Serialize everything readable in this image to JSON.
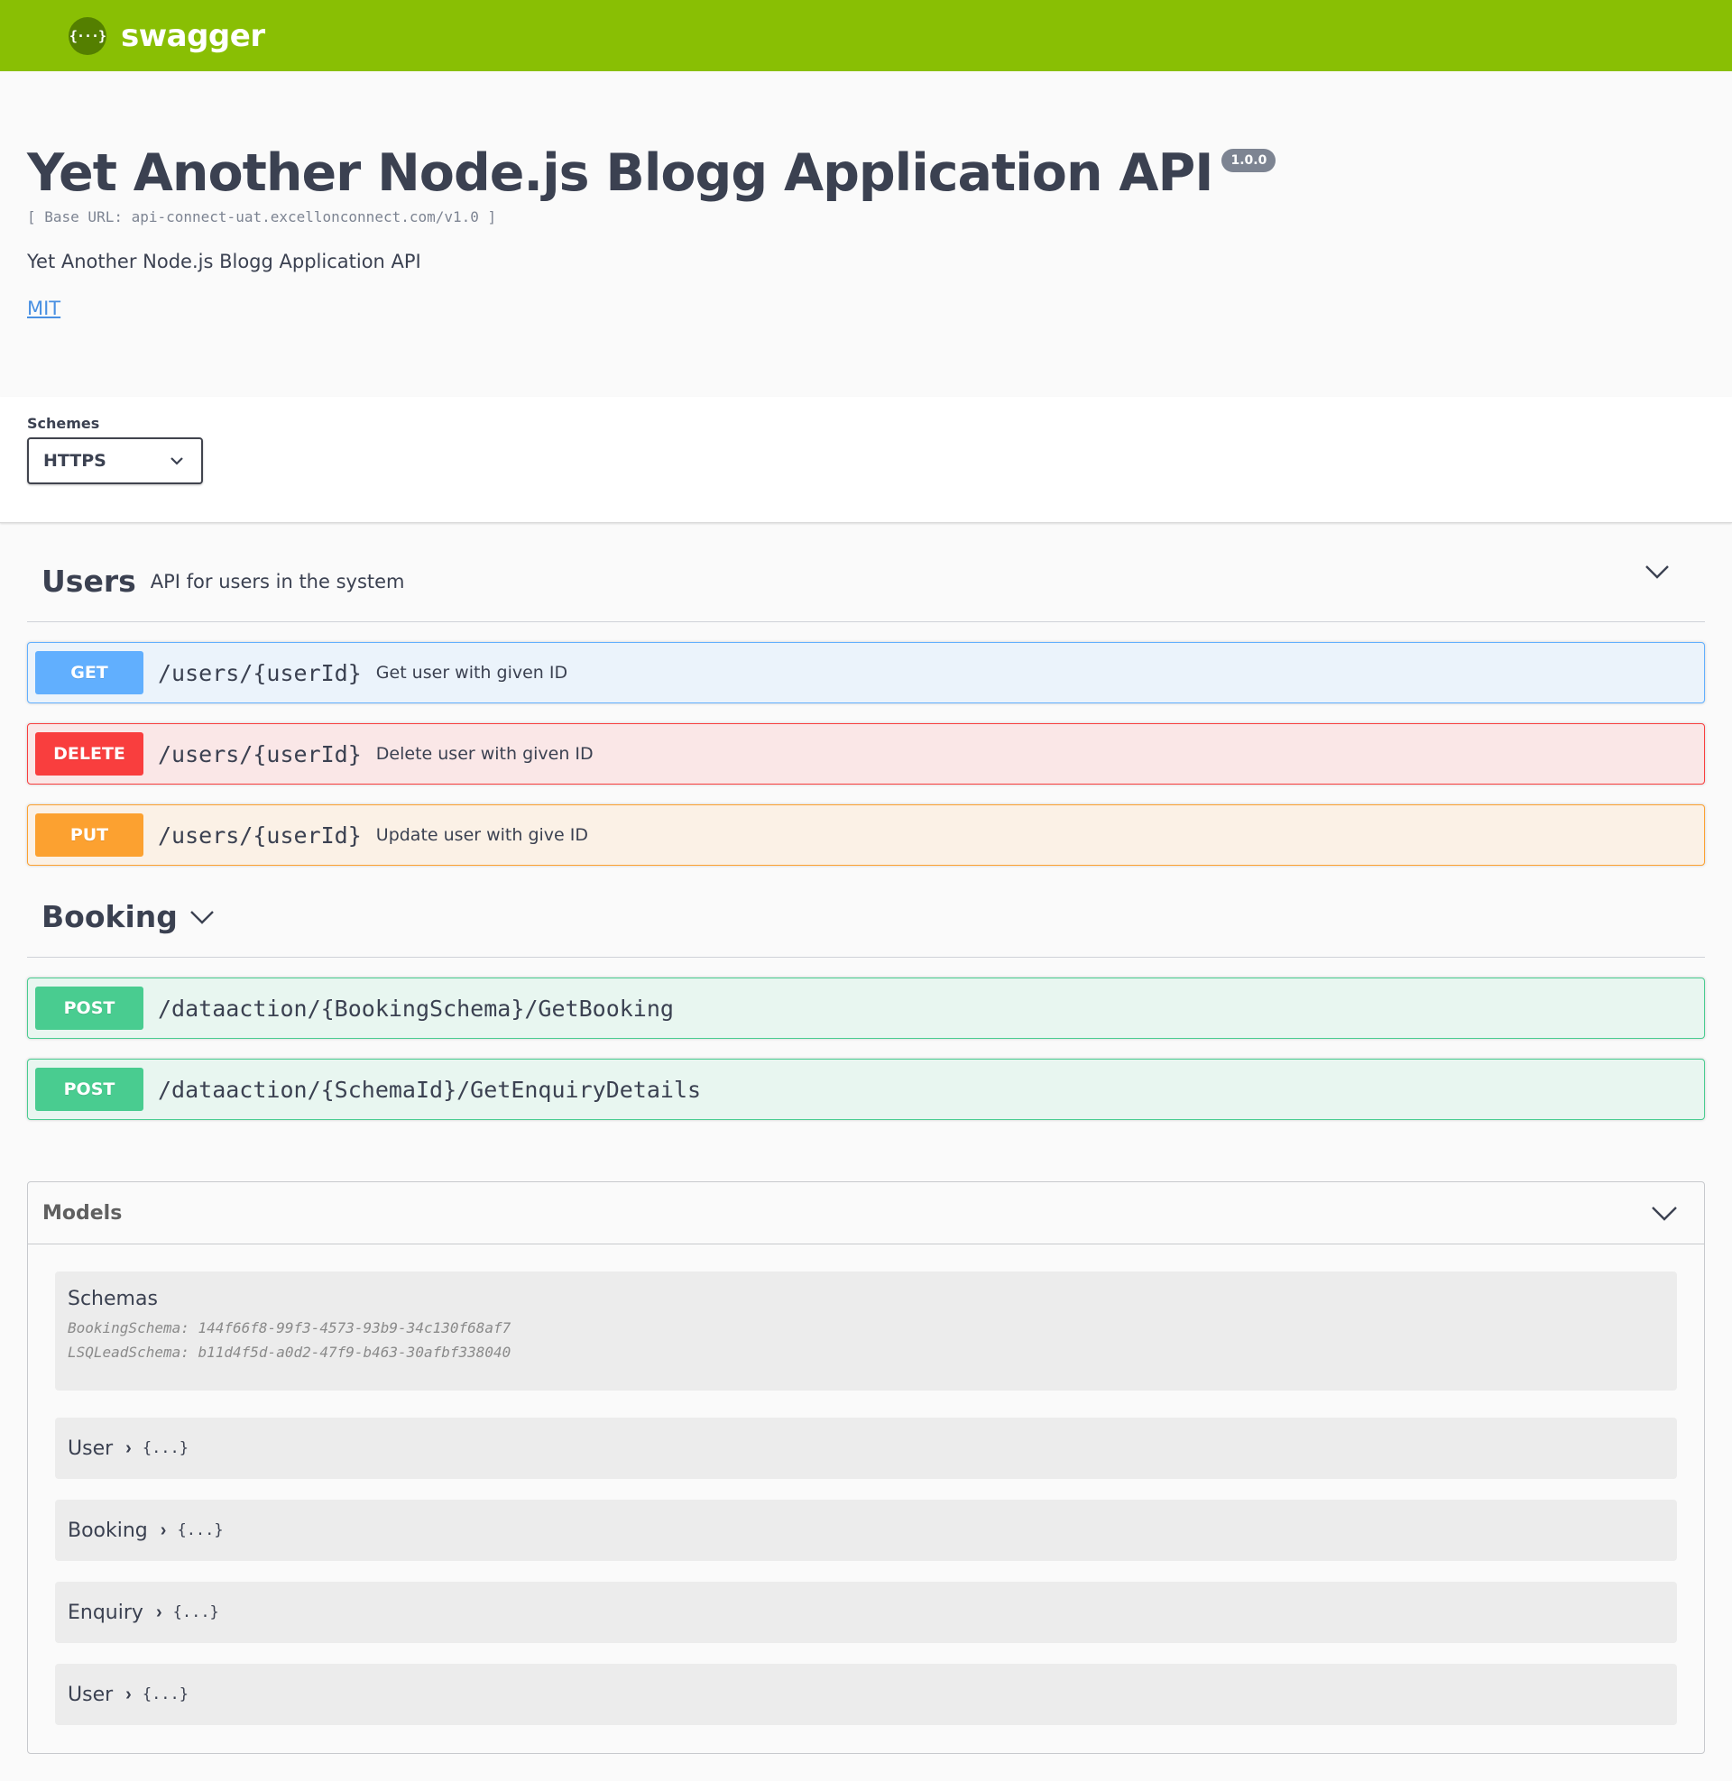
{
  "topbar": {
    "logo_glyph": "{···}",
    "brand": "swagger",
    "color": "#89bf04"
  },
  "info": {
    "title": "Yet Another Node.js Blogg Application API",
    "version": "1.0.0",
    "base_url": "[ Base URL: api-connect-uat.excellonconnect.com/v1.0 ]",
    "description": "Yet Another Node.js Blogg Application API",
    "license": "MIT"
  },
  "schemes": {
    "label": "Schemes",
    "selected": "HTTPS"
  },
  "tags": [
    {
      "name": "Users",
      "description": "API for users in the system",
      "operations": [
        {
          "method": "GET",
          "path": "/users/{userId}",
          "summary": "Get user with given ID"
        },
        {
          "method": "DELETE",
          "path": "/users/{userId}",
          "summary": "Delete user with given ID"
        },
        {
          "method": "PUT",
          "path": "/users/{userId}",
          "summary": "Update user with give ID"
        }
      ]
    },
    {
      "name": "Booking",
      "description": "",
      "operations": [
        {
          "method": "POST",
          "path": "/dataaction/{BookingSchema}/GetBooking",
          "summary": ""
        },
        {
          "method": "POST",
          "path": "/dataaction/{SchemaId}/GetEnquiryDetails",
          "summary": ""
        }
      ]
    }
  ],
  "models": {
    "title": "Models",
    "schemas": {
      "title": "Schemas",
      "lines": [
        "BookingSchema: 144f66f8-99f3-4573-93b9-34c130f68af7",
        "LSQLeadSchema: b11d4f5d-a0d2-47f9-b463-30afbf338040"
      ]
    },
    "items": [
      {
        "name": "User",
        "collapsed": "{...}"
      },
      {
        "name": "Booking",
        "collapsed": "{...}"
      },
      {
        "name": "Enquiry",
        "collapsed": "{...}"
      },
      {
        "name": "User",
        "collapsed": "{...}"
      }
    ]
  },
  "colors": {
    "get": "#61affe",
    "delete": "#f93e3e",
    "put": "#fca130",
    "post": "#49cc90",
    "link": "#4990e2"
  },
  "icons": {
    "expand": "chevron-down-icon",
    "model_expand": "chevron-right-icon"
  }
}
